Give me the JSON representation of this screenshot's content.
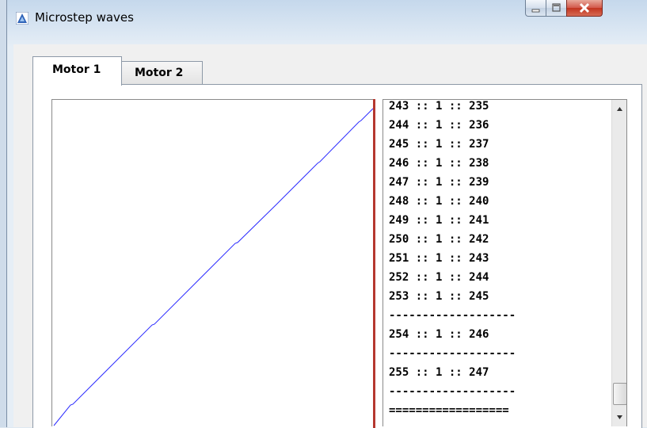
{
  "window": {
    "title": "Microstep waves"
  },
  "tabs": [
    {
      "label": "Motor 1",
      "selected": true
    },
    {
      "label": "Motor 2",
      "selected": false
    }
  ],
  "plot": {
    "line_color": "#2b2bff",
    "border_right_color": "#b5372f"
  },
  "list": {
    "lines": [
      "243 :: 1 :: 235",
      "244 :: 1 :: 236",
      "245 :: 1 :: 237",
      "246 :: 1 :: 238",
      "247 :: 1 :: 239",
      "248 :: 1 :: 240",
      "249 :: 1 :: 241",
      "250 :: 1 :: 242",
      "251 :: 1 :: 243",
      "252 :: 1 :: 244",
      "253 :: 1 :: 245",
      "-------------------",
      "254 :: 1 :: 246",
      "-------------------",
      "255 :: 1 :: 247",
      "-------------------",
      "=================="
    ]
  },
  "icons": {
    "app": "app-triangle-icon",
    "minimize": "minimize-icon",
    "maximize": "maximize-icon",
    "close": "close-icon",
    "scroll_up": "scroll-up-arrow-icon",
    "scroll_down": "scroll-down-arrow-icon"
  }
}
